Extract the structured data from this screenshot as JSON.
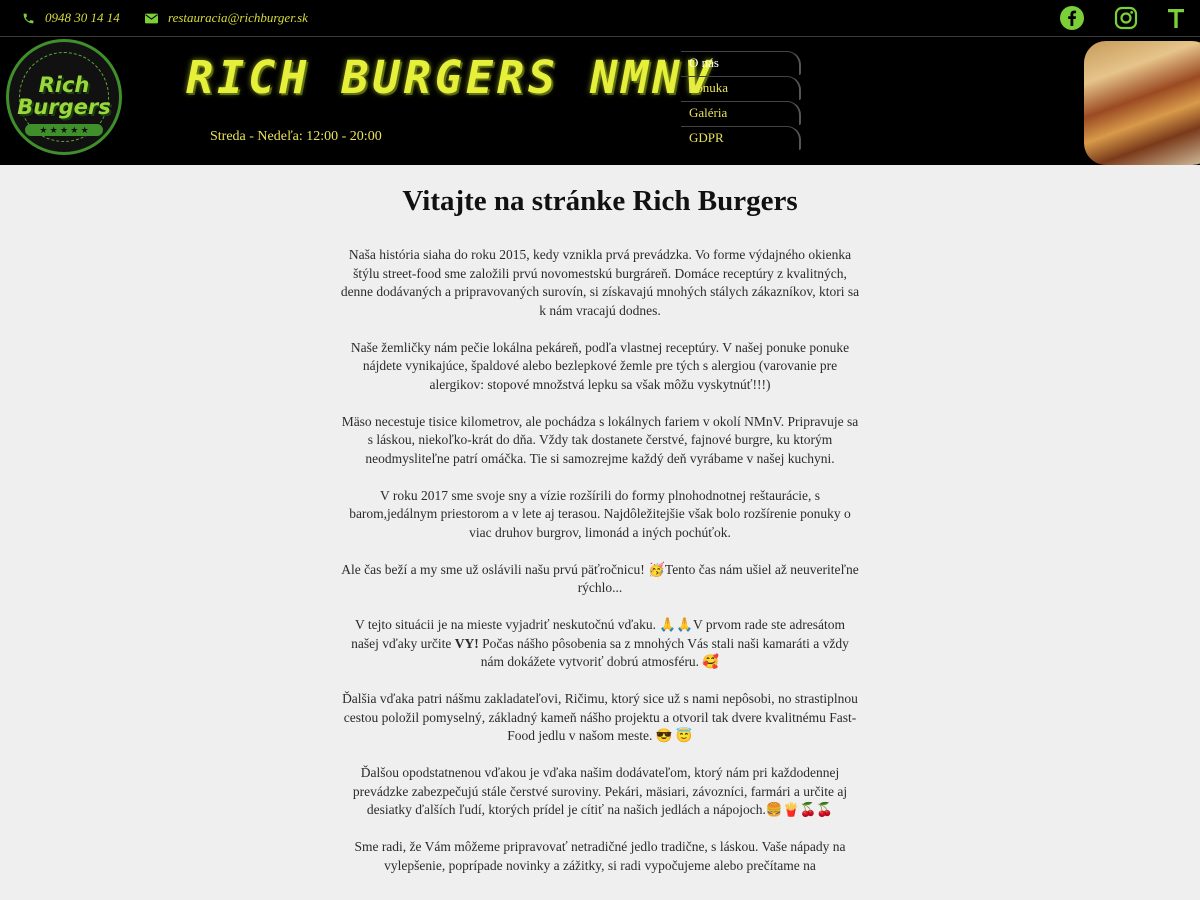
{
  "topbar": {
    "phone": "0948 30 14 14",
    "email": "restauracia@richburger.sk",
    "social": [
      "facebook-icon",
      "instagram-icon",
      "tripadvisor-icon"
    ],
    "accent_color": "#d8dc3a",
    "social_color": "#7bd03a"
  },
  "header": {
    "logo_text": "Rich Burgers",
    "brand": "RICH BURGERS NMNV",
    "hours": "Streda - Nedeľa: 12:00 - 20:00",
    "nav": [
      "O nás",
      "Ponuka",
      "Galéria",
      "GDPR"
    ],
    "active_nav": "O nás"
  },
  "main": {
    "title": "Vitajte na stránke Rich Burgers",
    "paragraphs": [
      "Naša história siaha do roku 2015, kedy vznikla prvá prevádzka. Vo forme výdajného okienka štýlu street-food sme založili prvú novomestskú burgráreň. Domáce receptúry z kvalitných, denne dodávaných a pripravovaných surovín, si získavajú mnohých stálych zákazníkov, ktori sa k nám vracajú dodnes.",
      "Naše žemličky nám pečie lokálna pekáreň, podľa vlastnej receptúry. V našej ponuke ponuke nájdete vynikajúce, špaldové alebo bezlepkové žemle pre tých s alergiou (varovanie pre alergikov: stopové množstvá lepku sa však môžu vyskytnúť!!!)",
      "Mäso necestuje tisice kilometrov, ale pochádza s lokálnych fariem v okolí NMnV. Pripravuje sa s láskou, niekoľko-krát do dňa. Vždy tak dostanete čerstvé, fajnové burgre, ku ktorým neodmysliteľne patrí omáčka. Tie si samozrejme každý deň vyrábame v našej kuchyni.",
      "V roku 2017 sme svoje sny a vízie rozšírili do formy plnohodnotnej reštaurácie, s barom,jedálnym priestorom a v lete aj terasou. Najdôležitejšie však bolo rozšírenie ponuky o viac druhov burgrov, limonád a iných pochúťok.",
      "Ale čas beží a my sme už oslávili našu prvú päťročnicu! 🥳Tento čas nám ušiel až neuveriteľne rýchlo...",
      "V tejto situácii je na mieste vyjadriť neskutočnú vďaku. 🙏🙏V prvom rade ste adresátom našej vďaky určite VY! Počas nášho pôsobenia sa z mnohých Vás stali naši kamaráti a vždy nám dokážete vytvoriť dobrú atmosféru. 🥰",
      "Ďalšia vďaka patri nášmu zakladateľovi, Ričimu, ktorý sice už s nami nepôsobi, no strastiplnou cestou položil pomyselný, základný kameň nášho projektu a otvoril tak dvere kvalitnému Fast-Food jedlu v našom meste. 😎 😇",
      "Ďalšou opodstatnenou vďakou je vďaka našim dodávateľom, ktorý nám pri každodennej prevádzke zabezpečujú stále čerstvé suroviny. Pekári, mäsiari, závozníci, farmári a určite aj desiatky ďalších ľudí, ktorých prídel je cítiť na našich jedlách a nápojoch.🍔🍟🍒🍒",
      "Sme radi, že Vám môžeme pripravovať netradičné jedlo tradične, s láskou. Vaše nápady na vylepšenie, poprípade novinky a zážitky, si radi vypočujeme alebo prečítame na"
    ]
  }
}
